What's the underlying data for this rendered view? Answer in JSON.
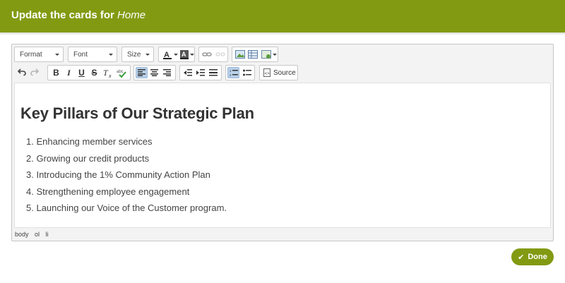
{
  "header": {
    "title_prefix": "Update the cards for",
    "title_emph": "Home"
  },
  "toolbar": {
    "format": "Format",
    "font": "Font",
    "size": "Size",
    "source": "Source"
  },
  "document": {
    "heading": "Key Pillars of Our Strategic Plan",
    "list": [
      "Enhancing member services",
      "Growing our credit products",
      "Introducing the 1% Community Action Plan",
      "Strengthening employee engagement",
      "Launching our Voice of the Customer program."
    ]
  },
  "statusbar": [
    "body",
    "ol",
    "li"
  ],
  "actions": {
    "done": "Done"
  },
  "colors": {
    "brand": "#829a12"
  }
}
